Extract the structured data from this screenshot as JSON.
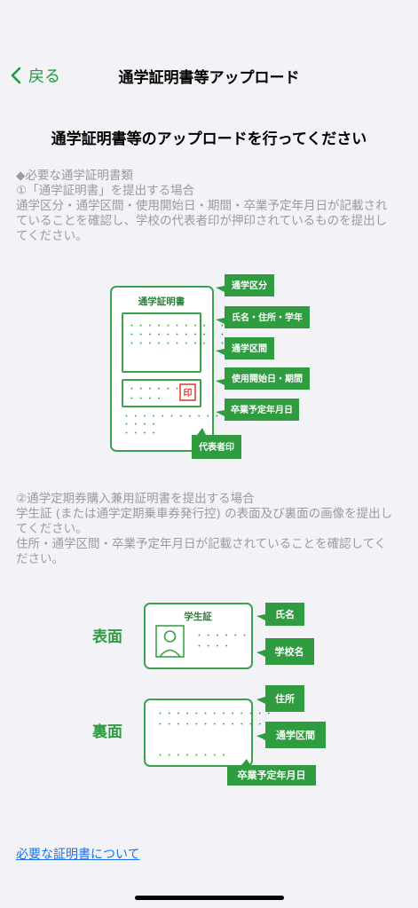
{
  "nav": {
    "back_label": "戻る",
    "title": "通学証明書等アップロード"
  },
  "heading": "通学証明書等のアップロードを行ってください",
  "section1": {
    "lines": [
      "◆必要な通学証明書類",
      "①「通学証明書」を提出する場合",
      "通学区分・通学区間・使用開始日・期間・卒業予定年月日が記載され",
      "ていることを確認し、学校の代表者印が押印されているものを提出し",
      "てください。"
    ]
  },
  "diagram1": {
    "card_title": "通学証明書",
    "stamp": "印",
    "dots_row": "・・・・・・・・・・・",
    "dots_short": "・・・・・・・",
    "dots_tiny": "・・・・",
    "tags": [
      "通学区分",
      "氏名・住所・学年",
      "通学区間",
      "使用開始日・期間",
      "卒業予定年月日",
      "代表者印"
    ]
  },
  "section2": {
    "lines": [
      "②通学定期券購入兼用証明書を提出する場合",
      "学生証 (または通学定期乗車券発行控) の表面及び裏面の画像を提出し",
      "てください。",
      "住所・通学区間・卒業予定年月日が記載されていることを確認してく",
      "ださい。"
    ]
  },
  "diagram2": {
    "front_label": "表面",
    "back_label": "裏面",
    "card_title": "学生証",
    "dots_front": "・・・・・・",
    "dots_front2": "・・・・",
    "dots_back": "・・・・・・・・・・・・・",
    "dots_back2": "・・・・・・・・",
    "tags_front": [
      "氏名",
      "学校名"
    ],
    "tags_back": [
      "住所",
      "通学区間",
      "卒業予定年月日"
    ]
  },
  "footer": {
    "link": "必要な証明書について"
  },
  "colors": {
    "accent": "#2f9c40",
    "link": "#1a73e8",
    "muted": "#9a9a9f"
  }
}
